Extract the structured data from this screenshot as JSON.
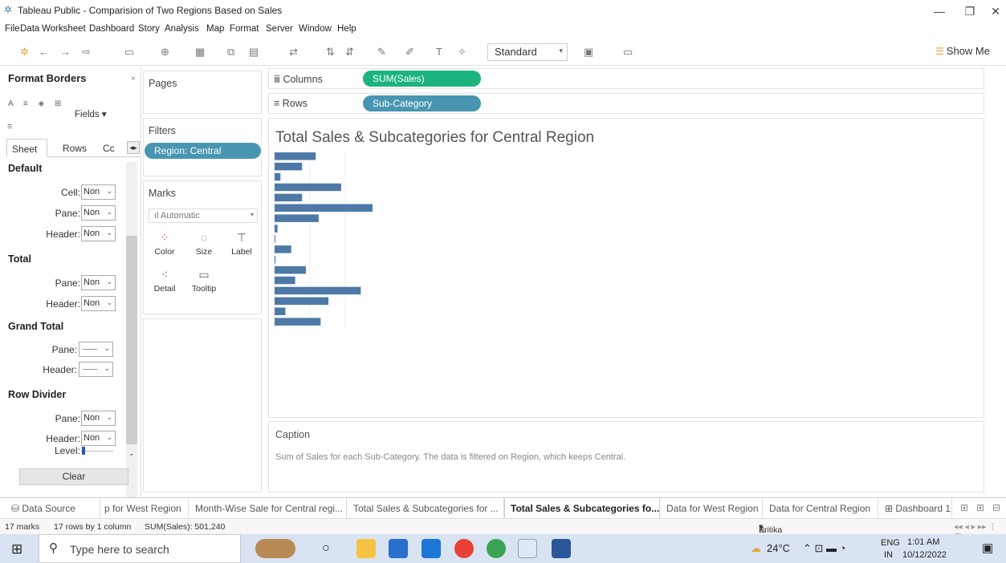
{
  "window": {
    "title": "Tableau Public - Comparision of Two Regions Based on Sales",
    "minimize": "—",
    "restore": "❐",
    "close": "✕"
  },
  "menu": [
    "File",
    "Data",
    "Worksheet",
    "Dashboard",
    "Story",
    "Analysis",
    "Map",
    "Format",
    "Server",
    "Window",
    "Help"
  ],
  "toolbar": {
    "fit": "Standard",
    "show_me": "Show Me"
  },
  "format_pane": {
    "title": "Format Borders",
    "fields_label": "Fields ▾",
    "tabs": [
      "Sheet",
      "Rows",
      "Cc"
    ],
    "sections": {
      "default": "Default",
      "total": "Total",
      "grand_total": "Grand Total",
      "row_divider": "Row Divider"
    },
    "labels": {
      "cell": "Cell:",
      "pane": "Pane:",
      "header": "Header:",
      "level": "Level:"
    },
    "none_value": "Non",
    "clear": "Clear"
  },
  "pages": {
    "title": "Pages"
  },
  "filters": {
    "title": "Filters",
    "pill": "Region: Central"
  },
  "marks": {
    "title": "Marks",
    "type": "Automatic",
    "buttons": {
      "color": "Color",
      "size": "Size",
      "label": "Label",
      "detail": "Detail",
      "tooltip": "Tooltip"
    }
  },
  "shelves": {
    "columns_label": "Columns",
    "columns_pill": "SUM(Sales)",
    "rows_label": "Rows",
    "rows_pill": "Sub-Category"
  },
  "view": {
    "title": "Total Sales & Subcategories for Central Region"
  },
  "chart_data": {
    "type": "bar",
    "orientation": "horizontal",
    "series": [
      {
        "values": [
          0.42,
          0.28,
          0.06,
          0.68,
          0.28,
          1.0,
          0.45,
          0.03,
          0.005,
          0.17,
          0.01,
          0.32,
          0.21,
          0.88,
          0.55,
          0.11,
          0.47
        ]
      }
    ],
    "bar_color": "#4e79a7",
    "axes_labels": "none visible",
    "grid": "vertical gridlines"
  },
  "caption": {
    "title": "Caption",
    "text": "Sum of Sales for each Sub-Category. The data is filtered on Region, which keeps Central."
  },
  "sheet_tabs": [
    "Data Source",
    "p for West Region",
    "Month-Wise Sale for Central regi...",
    "Total Sales & Subcategories for ...",
    "Total Sales & Subcategories fo...",
    "Data for West Region",
    "Data for Central Region",
    "Dashboard 1"
  ],
  "status": {
    "marks": "17 marks",
    "dims": "17 rows by 1 column",
    "sum": "SUM(Sales): 501,240",
    "user": "Kritika setia"
  },
  "taskbar": {
    "search_placeholder": "Type here to search",
    "temp": "24°C",
    "lang1": "ENG",
    "lang2": "IN",
    "time": "1:01 AM",
    "date": "10/12/2022"
  },
  "colors": {
    "green_pill": "#1bb47e",
    "blue_pill": "#4996b2",
    "bar": "#4e79a7"
  }
}
